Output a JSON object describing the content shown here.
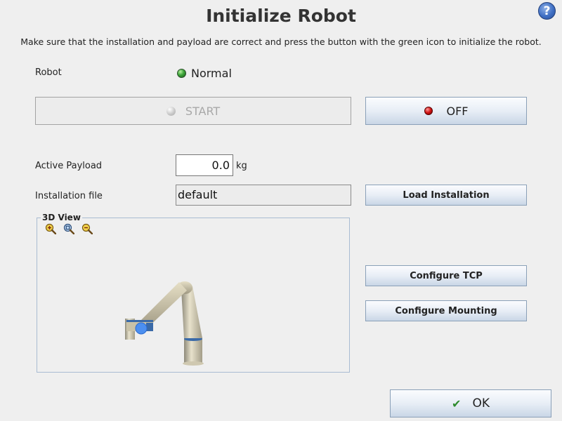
{
  "header": {
    "title": "Initialize Robot",
    "help_glyph": "?"
  },
  "instructions": "Make sure that the installation and payload are correct and press the button with the green icon to initialize the robot.",
  "robot": {
    "label": "Robot",
    "status": "Normal",
    "status_color": "#3da53a"
  },
  "controls": {
    "start_label": "START",
    "start_enabled": false,
    "off_label": "OFF",
    "off_led_color": "#d11212"
  },
  "payload": {
    "label": "Active Payload",
    "value": "0.0",
    "unit": "kg"
  },
  "installation": {
    "label": "Installation file",
    "value": "default",
    "load_label": "Load Installation"
  },
  "view3d": {
    "title": "3D View",
    "zoom_icons": [
      "zoom-in-icon",
      "zoom-fit-icon",
      "zoom-out-icon"
    ]
  },
  "actions": {
    "configure_tcp": "Configure TCP",
    "configure_mounting": "Configure Mounting",
    "ok": "OK"
  },
  "colors": {
    "button_gradient_top": "#fbfcfe",
    "button_gradient_bottom": "#c9d6e6",
    "button_border": "#8aa0b8",
    "help_blue": "#3f6fc4",
    "ok_check": "#2e8b2e"
  }
}
